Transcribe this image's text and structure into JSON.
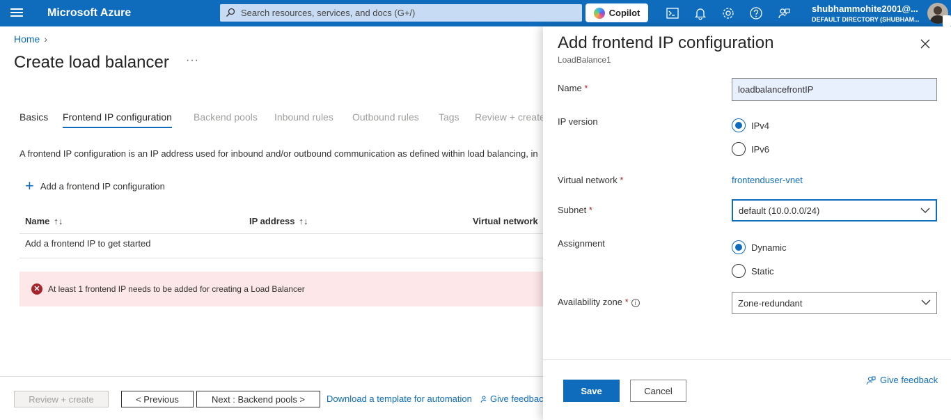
{
  "topbar": {
    "brand": "Microsoft Azure",
    "search_placeholder": "Search resources, services, and docs (G+/)",
    "copilot_label": "Copilot",
    "icons": [
      "cloud-shell-icon",
      "bell-icon",
      "gear-icon",
      "help-icon",
      "feedback-icon"
    ],
    "user_name": "shubhammohite2001@...",
    "user_directory": "DEFAULT DIRECTORY (SHUBHAM..."
  },
  "page": {
    "breadcrumb_home": "Home",
    "title": "Create load balancer",
    "more": "···",
    "tabs": [
      {
        "label": "Basics",
        "state": "visited"
      },
      {
        "label": "Frontend IP configuration",
        "state": "active"
      },
      {
        "label": "Backend pools",
        "state": "disabled"
      },
      {
        "label": "Inbound rules",
        "state": "disabled"
      },
      {
        "label": "Outbound rules",
        "state": "disabled"
      },
      {
        "label": "Tags",
        "state": "disabled"
      },
      {
        "label": "Review + create",
        "state": "disabled"
      }
    ],
    "description": "A frontend IP configuration is an IP address used for inbound and/or outbound communication as defined within load balancing, in",
    "add_config_label": "Add a frontend IP configuration",
    "table": {
      "columns": [
        "Name",
        "IP address",
        "Virtual network"
      ],
      "sort_glyph": "↑↓",
      "empty_text": "Add a frontend IP to get started"
    },
    "error_message": "At least 1 frontend IP needs to be added for creating a Load Balancer"
  },
  "footer": {
    "review_create": "Review + create",
    "previous": "< Previous",
    "next": "Next : Backend pools >",
    "download_template": "Download a template for automation",
    "give_feedback": "Give feedback"
  },
  "panel": {
    "title": "Add frontend IP configuration",
    "subtitle": "LoadBalance1",
    "name_label": "Name",
    "name_value": "loadbalancefrontIP",
    "ip_version_label": "IP version",
    "ip_options": [
      "IPv4",
      "IPv6"
    ],
    "ip_selected": "IPv4",
    "vnet_label": "Virtual network",
    "vnet_value": "frontenduser-vnet",
    "subnet_label": "Subnet",
    "subnet_value": "default (10.0.0.0/24)",
    "assignment_label": "Assignment",
    "assignment_options": [
      "Dynamic",
      "Static"
    ],
    "assignment_selected": "Dynamic",
    "zone_label": "Availability zone",
    "zone_value": "Zone-redundant",
    "required_mark": "*",
    "save": "Save",
    "cancel": "Cancel",
    "give_feedback": "Give feedback"
  },
  "colors": {
    "accent": "#0f6cbd",
    "error": "#a4262c",
    "error_bg": "#fde7e9"
  }
}
